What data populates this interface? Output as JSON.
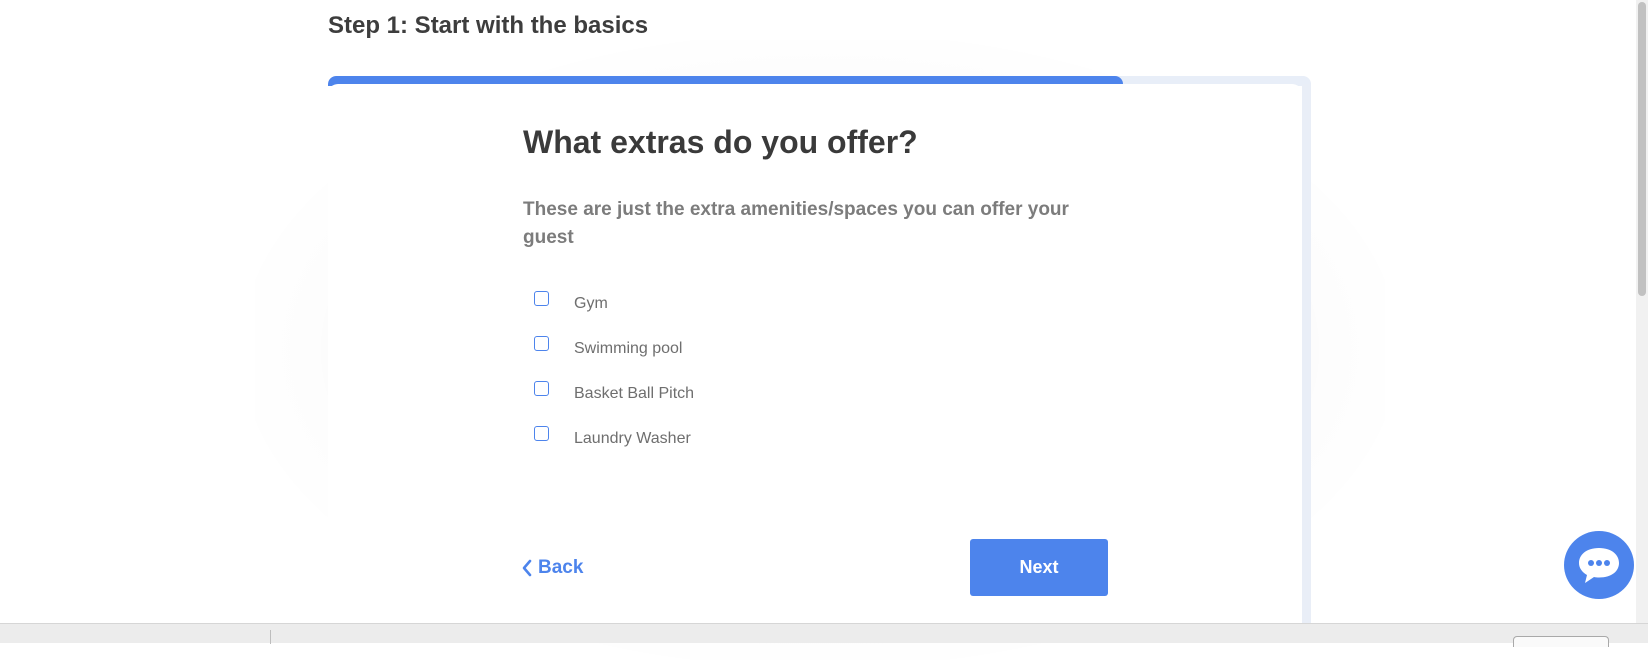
{
  "header": {
    "step_title": "Step 1: Start with the basics"
  },
  "progress": {
    "fraction": 0.809
  },
  "question": {
    "title": "What extras do you offer?",
    "subtitle": "These are just the extra amenities/spaces you can offer your guest"
  },
  "options": [
    {
      "label": "Gym",
      "checked": false
    },
    {
      "label": "Swimming pool",
      "checked": false
    },
    {
      "label": "Basket Ball Pitch",
      "checked": false
    },
    {
      "label": "Laundry Washer",
      "checked": false
    }
  ],
  "nav": {
    "back_label": "Back",
    "next_label": "Next"
  },
  "icons": {
    "back": "chevron-left-icon",
    "chat": "chat-bubble-icon"
  },
  "colors": {
    "accent": "#4d84ec",
    "text": "#3a3a3a",
    "muted": "#7c7c7c"
  }
}
